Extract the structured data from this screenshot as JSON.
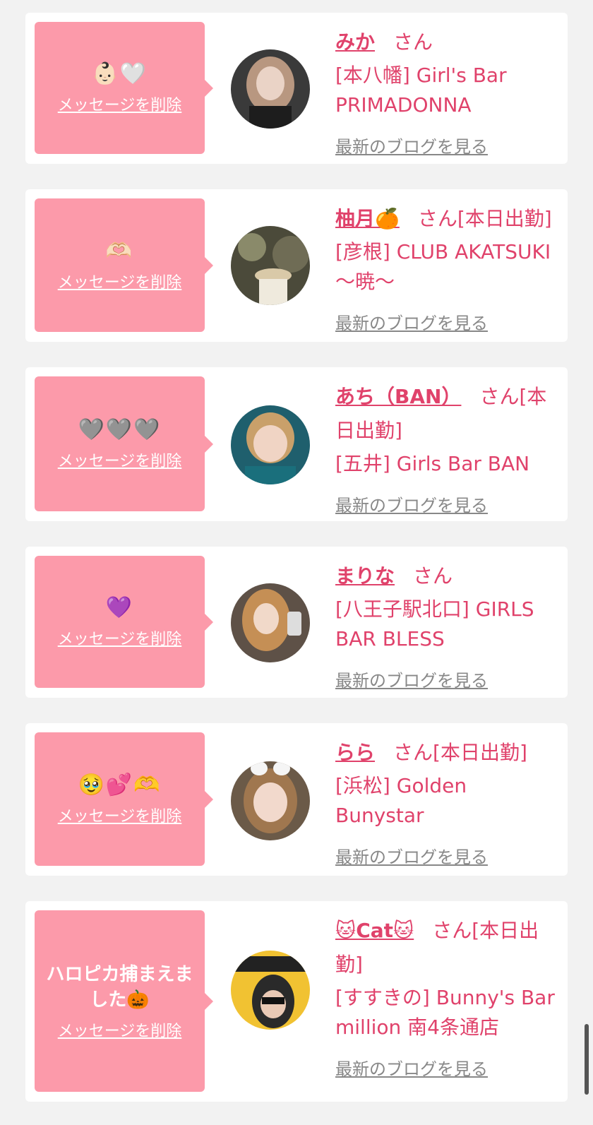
{
  "cards": [
    {
      "message": "👶🏻🤍",
      "delete_label": "メッセージを削除",
      "name": "みか",
      "honorific": "さん",
      "shop": "[本八幡] Girl's Bar PRIMADONNA",
      "blog_label": "最新のブログを見る"
    },
    {
      "message": "🫶🏻",
      "delete_label": "メッセージを削除",
      "name": "柚月🍊",
      "honorific": "さん[本日出勤]",
      "shop": "[彦根] CLUB AKATSUKI 〜暁〜",
      "blog_label": "最新のブログを見る"
    },
    {
      "message": "🩶🩶🩶",
      "delete_label": "メッセージを削除",
      "name": "あち（BAN）",
      "honorific": "さん[本日出勤]",
      "shop": "[五井] Girls Bar BAN",
      "blog_label": "最新のブログを見る"
    },
    {
      "message": "💜",
      "delete_label": "メッセージを削除",
      "name": "まりな",
      "honorific": "さん",
      "shop": "[八王子駅北口] GIRLS BAR BLESS",
      "blog_label": "最新のブログを見る"
    },
    {
      "message": "🥹💕🫶",
      "delete_label": "メッセージを削除",
      "name": "らら",
      "honorific": "さん[本日出勤]",
      "shop": "[浜松] Golden Bunystar",
      "blog_label": "最新のブログを見る"
    },
    {
      "message": "ハロピカ捕まえました🎃",
      "delete_label": "メッセージを削除",
      "name": "🐱Cat🐱",
      "honorific": "さん[本日出勤]",
      "shop": "[すすきの] Bunny's Bar million 南4条通店",
      "blog_label": "最新のブログを見る"
    }
  ],
  "colors": {
    "accent": "#e0426b",
    "bubble": "#fc9aaa",
    "background": "#f2f2f2"
  }
}
